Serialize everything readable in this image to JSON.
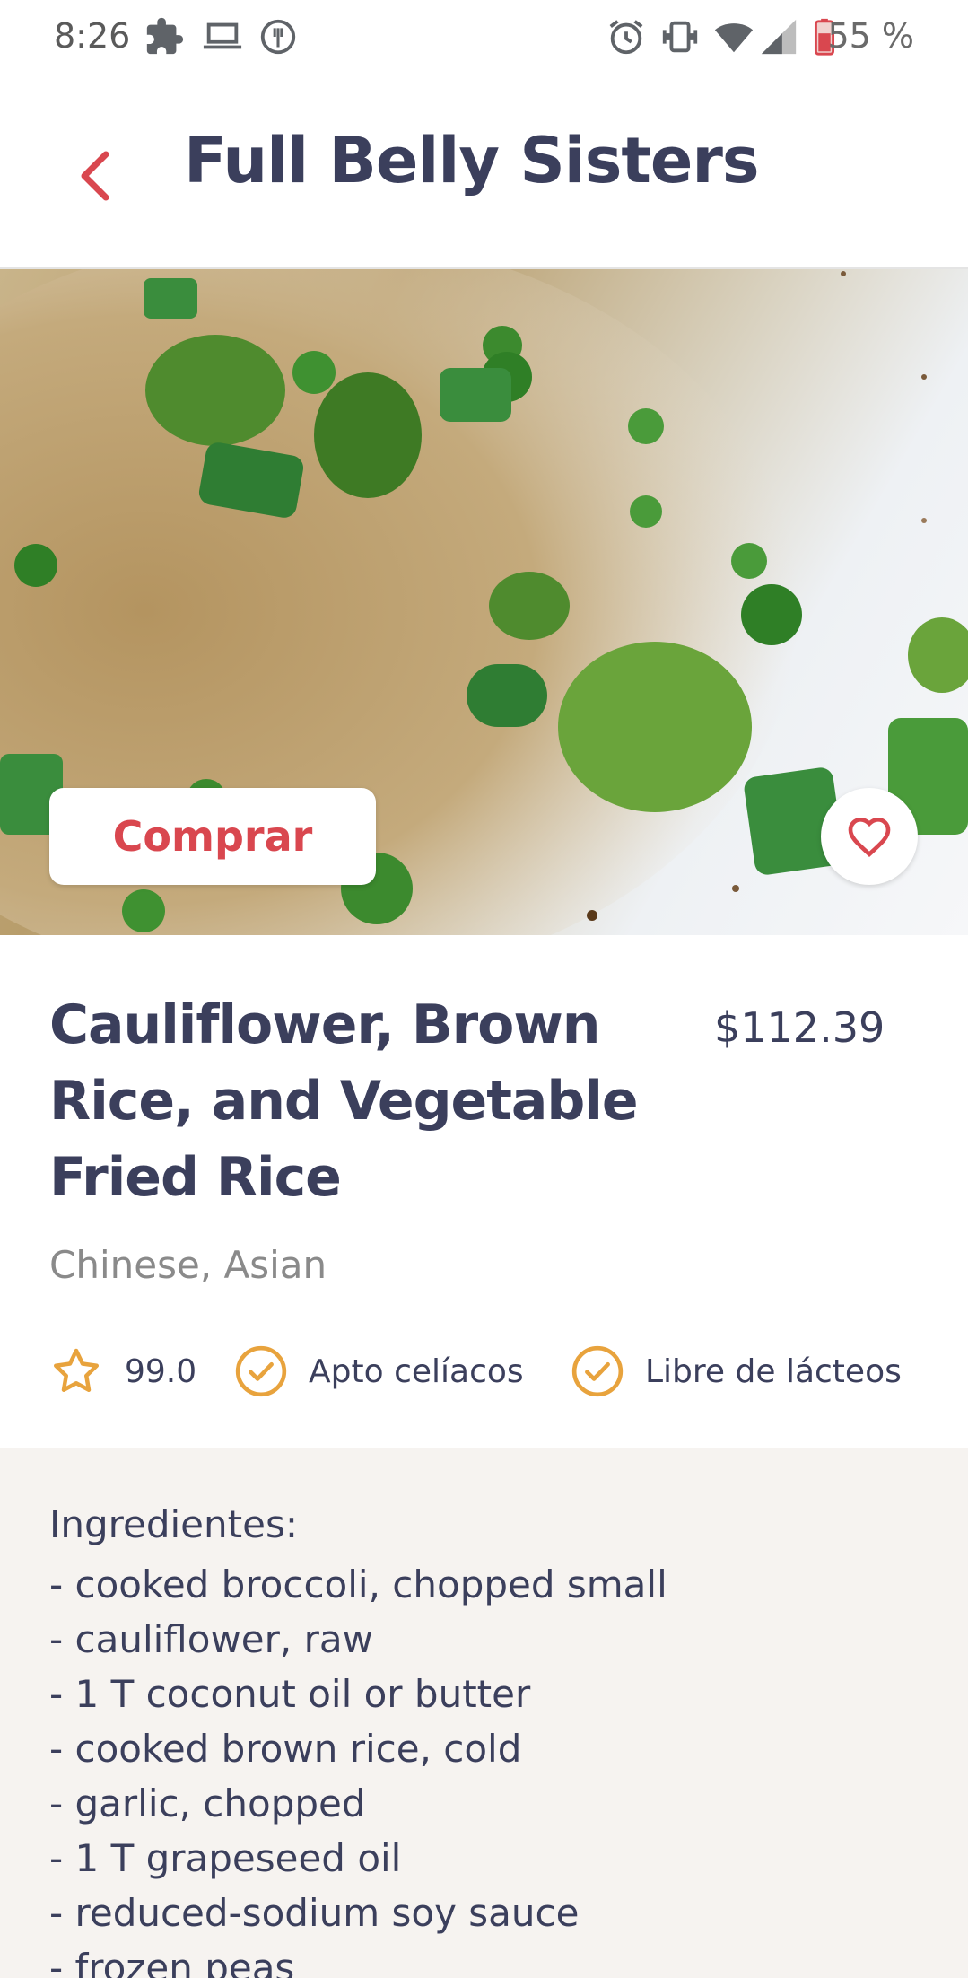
{
  "status_bar": {
    "time": "8:26",
    "battery": "55 %",
    "icons": [
      "puzzle-icon",
      "laptop-icon",
      "recipe-app-icon",
      "alarm-icon",
      "vibrate-icon",
      "wifi-icon",
      "signal-icon",
      "battery-icon"
    ]
  },
  "app_bar": {
    "title": "Full Belly Sisters",
    "back_icon": "chevron-left-icon",
    "accent_color": "#d9474f"
  },
  "hero": {
    "buy_label": "Comprar",
    "favorite_icon": "heart-outline-icon"
  },
  "recipe": {
    "title": "Cauliflower, Brown Rice, and Vegetable Fried Rice",
    "price": "$112.39",
    "cuisine": "Chinese, Asian",
    "rating": "99.0",
    "tags": [
      {
        "label": "Apto celíacos",
        "icon": "check-circle-icon"
      },
      {
        "label": "Libre de lácteos",
        "icon": "check-circle-icon"
      }
    ],
    "tag_color": "#e8a33d",
    "title_color": "#3b3f5c"
  },
  "ingredients": {
    "heading": "Ingredientes:",
    "items": [
      "- cooked broccoli, chopped small",
      "- cauliflower, raw",
      "- 1 T coconut oil or butter",
      "- cooked brown rice, cold",
      "- garlic, chopped",
      "- 1 T grapeseed oil",
      "- reduced-sodium soy sauce",
      "- frozen peas"
    ]
  }
}
